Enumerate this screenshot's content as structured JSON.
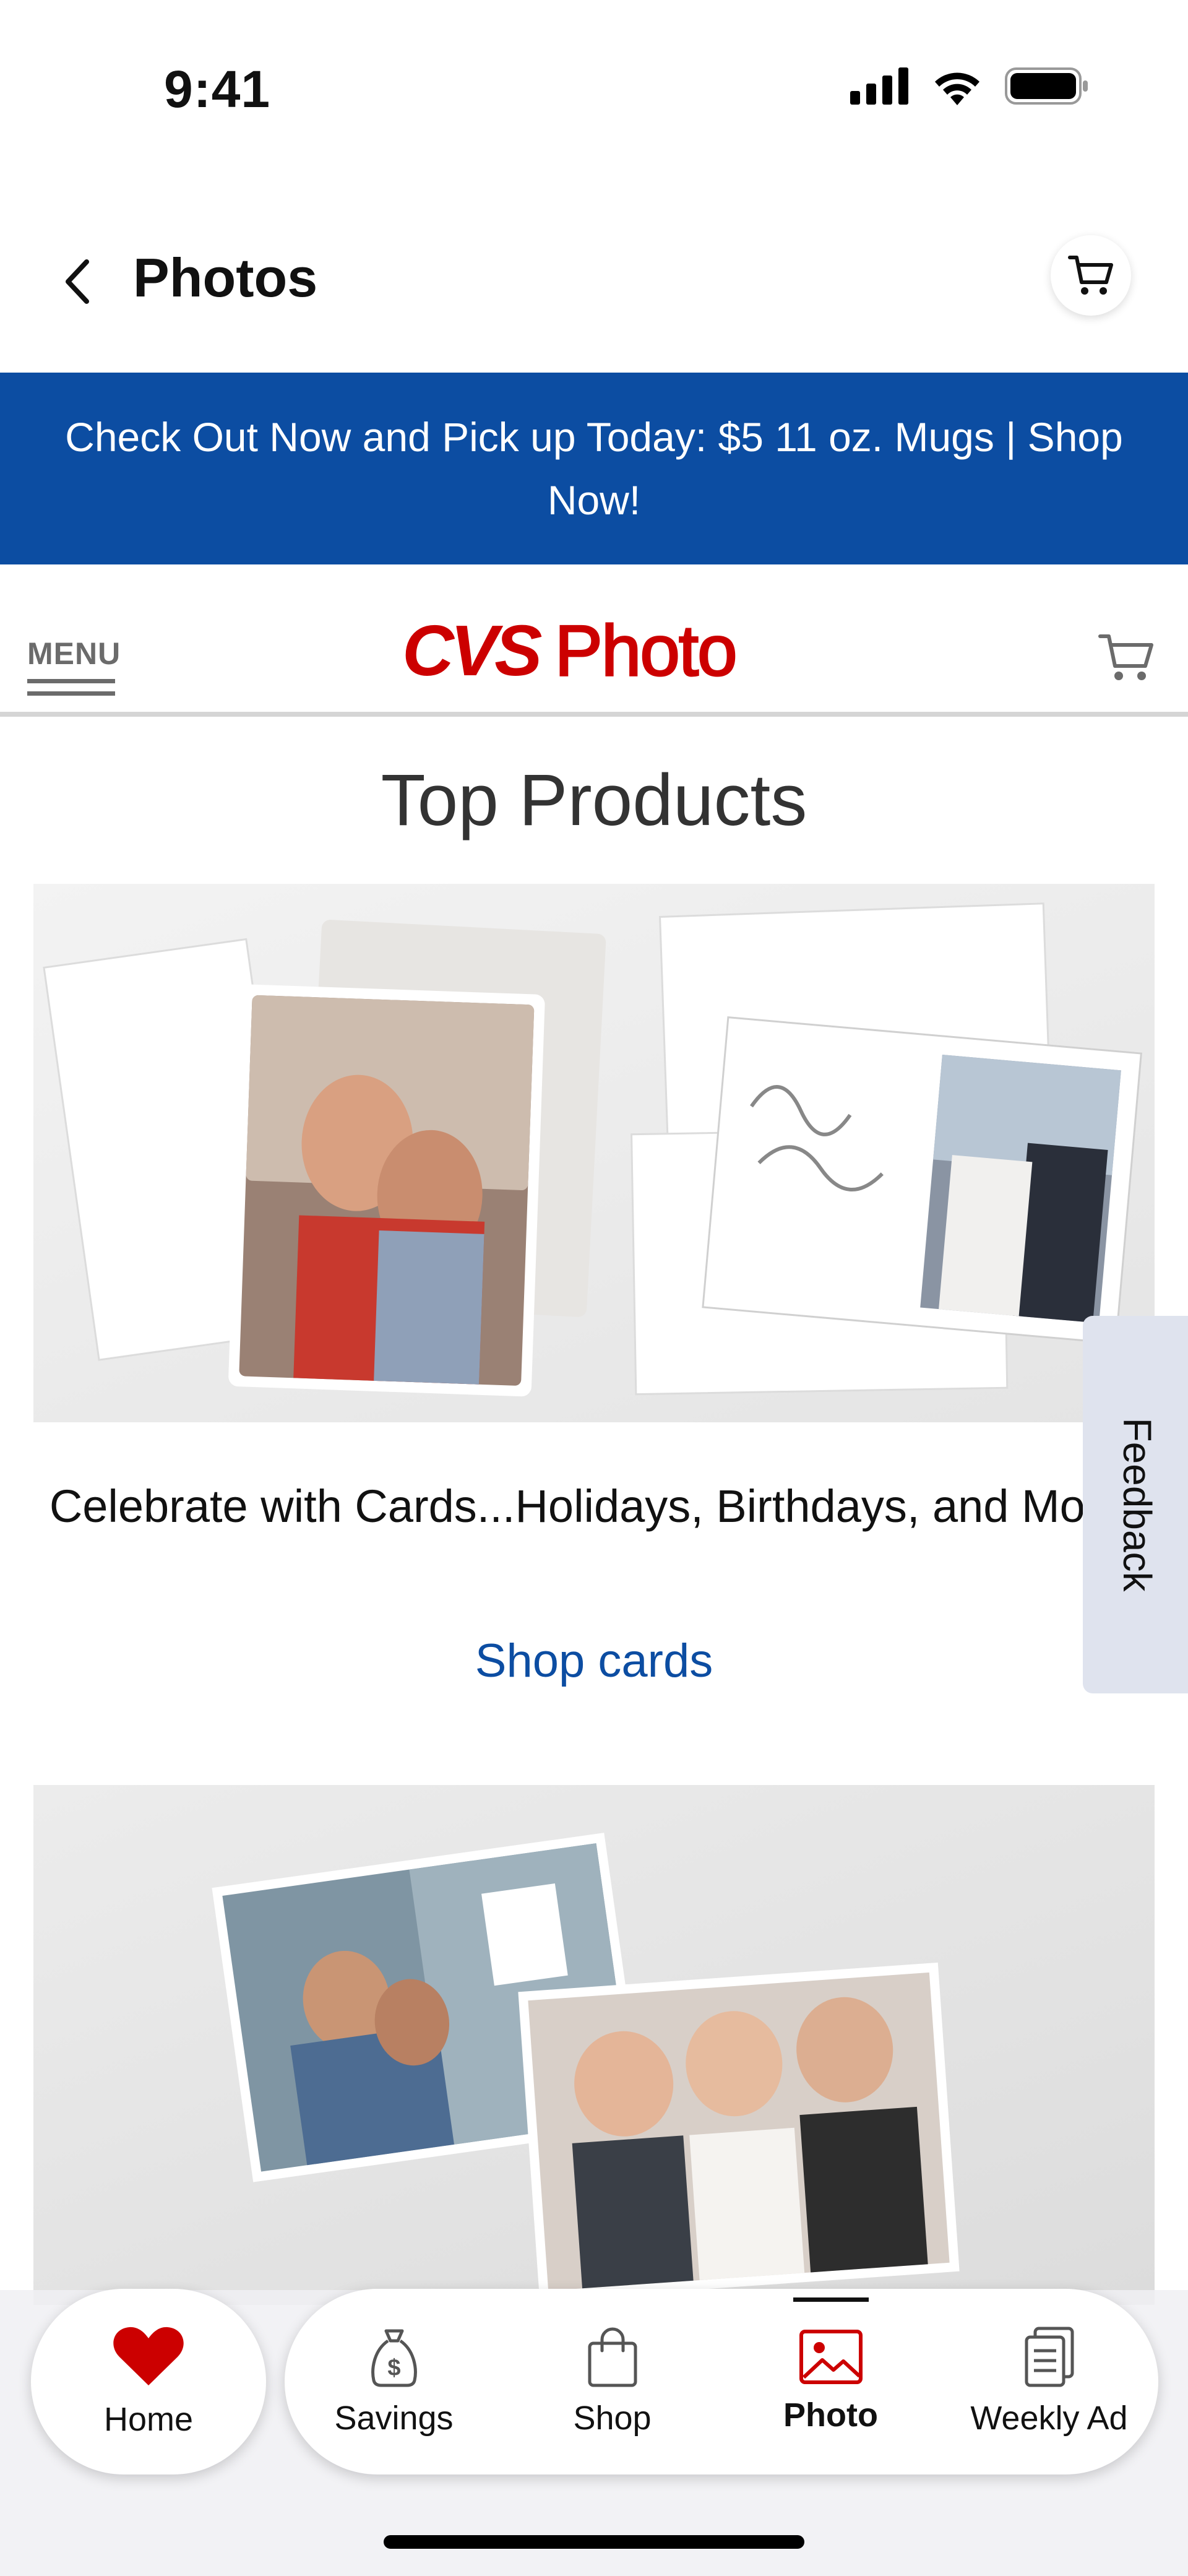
{
  "status_bar": {
    "time": "9:41"
  },
  "nav": {
    "title": "Photos"
  },
  "promo": {
    "text": "Check Out Now and Pick up Today: $5 11 oz. Mugs | Shop Now!"
  },
  "cvs_header": {
    "menu_label": "MENU",
    "logo_brand": "CVS",
    "logo_product": "Photo"
  },
  "main": {
    "section_title": "Top Products",
    "cards_promo": {
      "description": "Celebrate with Cards...Holidays, Birthdays, and More!",
      "link_label": "Shop cards"
    }
  },
  "feedback": {
    "label": "Feedback"
  },
  "tab_bar": {
    "home_label": "Home",
    "tabs": [
      {
        "label": "Savings",
        "icon": "savings-bag-icon"
      },
      {
        "label": "Shop",
        "icon": "shopping-bag-icon"
      },
      {
        "label": "Photo",
        "icon": "photo-icon",
        "active": true
      },
      {
        "label": "Weekly Ad",
        "icon": "weekly-ad-icon"
      }
    ]
  },
  "colors": {
    "brand_red": "#cc0000",
    "banner_blue": "#0c4da2",
    "link_blue": "#0c4da2",
    "home_heart": "#cc0000"
  }
}
